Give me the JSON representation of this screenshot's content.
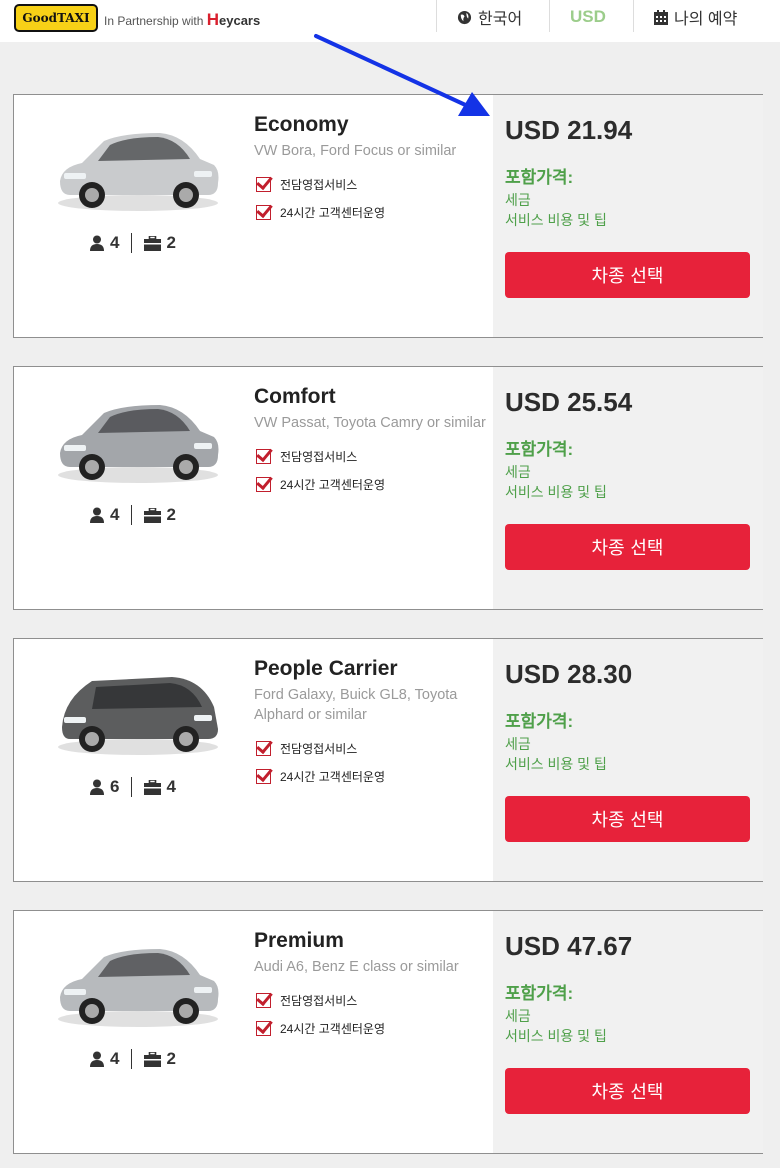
{
  "header": {
    "logo_text": "GoodTAXI",
    "partner_text": "In Partnership with",
    "partner_brand_initial": "H",
    "partner_brand_rest": "eycars",
    "language_label": "한국어",
    "currency_label": "USD",
    "my_booking_label": "나의 예약",
    "icons": {
      "language": "globe-icon",
      "booking": "calendar-icon"
    },
    "colors": {
      "logo_bg": "#f7d117",
      "currency": "#9ccd8b",
      "brand_h": "#d9202e"
    }
  },
  "annotation": {
    "arrow_color": "#1433e6"
  },
  "theme": {
    "button": "#e7223a",
    "included": "#4fa04a"
  },
  "cars": [
    {
      "name": "Economy",
      "similar": "VW Bora, Ford Focus or similar",
      "passengers": "4",
      "luggage": "2",
      "features": [
        "전담영접서비스",
        "24시간 고객센터운영"
      ],
      "price": "USD 21.94",
      "included_title": "포함가격:",
      "included": [
        "세금",
        "서비스 비용 및 팁"
      ],
      "button": "차종 선택",
      "car_color": "#c9cbcd"
    },
    {
      "name": "Comfort",
      "similar": "VW Passat, Toyota Camry or similar",
      "passengers": "4",
      "luggage": "2",
      "features": [
        "전담영접서비스",
        "24시간 고객센터운영"
      ],
      "price": "USD 25.54",
      "included_title": "포함가격:",
      "included": [
        "세금",
        "서비스 비용 및 팁"
      ],
      "button": "차종 선택",
      "car_color": "#a3a6aa"
    },
    {
      "name": "People Carrier",
      "similar": "Ford Galaxy, Buick GL8, Toyota Alphard or similar",
      "passengers": "6",
      "luggage": "4",
      "features": [
        "전담영접서비스",
        "24시간 고객센터운영"
      ],
      "price": "USD 28.30",
      "included_title": "포함가격:",
      "included": [
        "세금",
        "서비스 비용 및 팁"
      ],
      "button": "차종 선택",
      "car_color": "#5c5d5e"
    },
    {
      "name": "Premium",
      "similar": "Audi A6, Benz E class or similar",
      "passengers": "4",
      "luggage": "2",
      "features": [
        "전담영접서비스",
        "24시간 고객센터운영"
      ],
      "price": "USD 47.67",
      "included_title": "포함가격:",
      "included": [
        "세금",
        "서비스 비용 및 팁"
      ],
      "button": "차종 선택",
      "car_color": "#b7babd"
    }
  ]
}
